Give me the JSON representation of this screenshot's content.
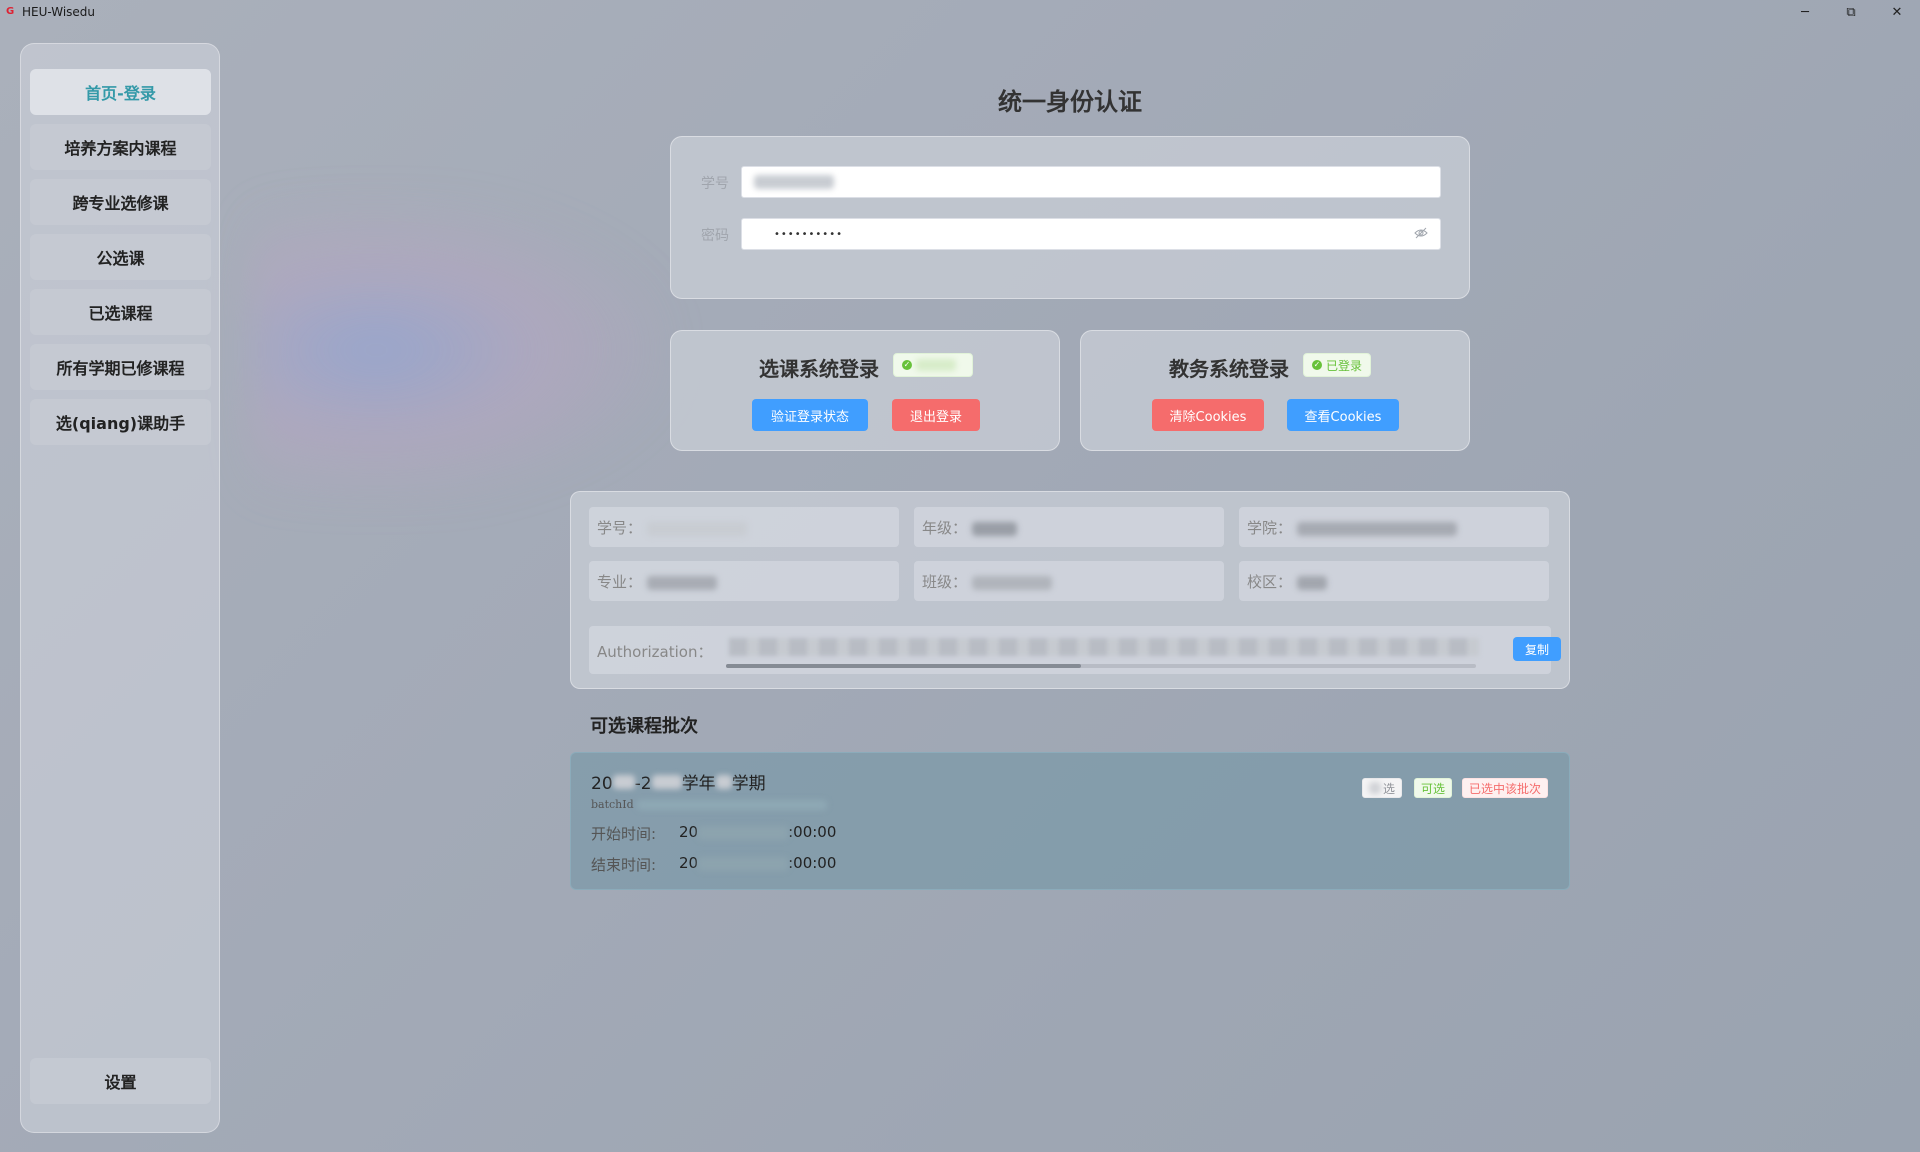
{
  "app": {
    "title": "HEU-Wisedu",
    "icon": "app-logo-icon"
  },
  "window_controls": {
    "minimize": "─",
    "maximize": "⧉",
    "close": "✕"
  },
  "sidebar": {
    "items": [
      {
        "label": "首页-登录",
        "active": true
      },
      {
        "label": "培养方案内课程"
      },
      {
        "label": "跨专业选修课"
      },
      {
        "label": "公选课"
      },
      {
        "label": "已选课程"
      },
      {
        "label": "所有学期已修课程"
      },
      {
        "label": "选(qiang)课助手"
      }
    ],
    "settings_label": "设置"
  },
  "auth": {
    "title": "统一身份认证",
    "student_id_label": "学号",
    "password_label": "密码",
    "password_value": "••••••••••"
  },
  "course_login": {
    "title": "选课系统登录",
    "verify_button": "验证登录状态",
    "logout_button": "退出登录"
  },
  "edu_login": {
    "title": "教务系统登录",
    "status": "已登录",
    "clear_cookies_button": "清除Cookies",
    "view_cookies_button": "查看Cookies"
  },
  "info": {
    "student_id_label": "学号：",
    "grade_label": "年级：",
    "college_label": "学院：",
    "major_label": "专业：",
    "class_label": "班级：",
    "campus_label": "校区：",
    "authorization_label": "Authorization：",
    "copy_button": "复制"
  },
  "batches": {
    "section_title": "可选课程批次",
    "items": [
      {
        "name_prefix": "20",
        "name_mid1": "-2",
        "name_mid2": "学年",
        "name_suffix": "学期",
        "id_label": "batchId",
        "start_label": "开始时间:",
        "start_prefix": "20",
        "start_suffix": ":00:00",
        "end_label": "结束时间:",
        "end_prefix": "20",
        "end_suffix": ":00:00",
        "tag_selected": "选",
        "tag_available": "可选",
        "tag_chosen_batch": "已选中该批次"
      }
    ]
  },
  "colors": {
    "primary": "#409eff",
    "danger": "#f56c6c",
    "success": "#67c23a",
    "active_nav": "#3399a8"
  }
}
